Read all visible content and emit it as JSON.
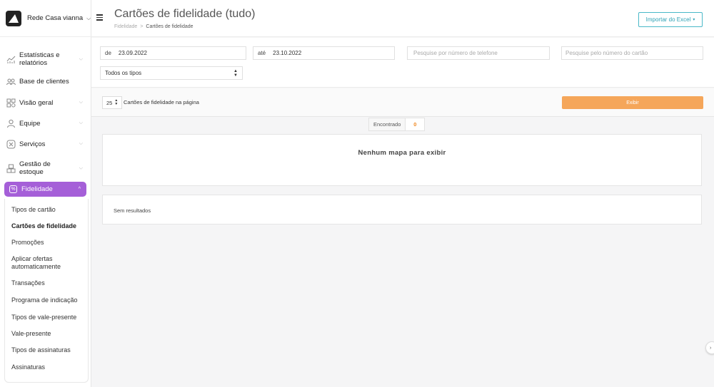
{
  "brand": {
    "name": "Rede Casa vianna"
  },
  "nav": {
    "items": [
      {
        "label": "Estatísticas e relatórios",
        "icon": "chart-icon"
      },
      {
        "label": "Base de clientes",
        "icon": "users-icon"
      },
      {
        "label": "Visão geral",
        "icon": "grid-icon"
      },
      {
        "label": "Equipe",
        "icon": "person-icon"
      },
      {
        "label": "Serviços",
        "icon": "scissors-icon"
      },
      {
        "label": "Gestão de estoque",
        "icon": "boxes-icon"
      }
    ],
    "active": {
      "label": "Fidelidade",
      "icon": "percent-icon"
    },
    "sub_items": [
      "Tipos de cartão",
      "Cartões de fidelidade",
      "Promoções",
      "Aplicar ofertas automaticamente",
      "Transações",
      "Programa de indicação",
      "Tipos de vale-presente",
      "Vale-presente",
      "Tipos de assinaturas",
      "Assinaturas"
    ]
  },
  "header": {
    "title": "Cartões de fidelidade (tudo)",
    "breadcrumb": {
      "parent": "Fidelidade",
      "separator": ">",
      "current": "Cartões de fidelidade"
    },
    "import_button": "Importar do Excel"
  },
  "filters": {
    "from_label": "de",
    "from_value": "23.09.2022",
    "to_label": "até",
    "to_value": "23.10.2022",
    "phone_placeholder": "Pesquise por número de telefone",
    "card_placeholder": "Pesquise pelo número do cartão",
    "type_select": "Todos os tipos"
  },
  "pager": {
    "per_page": "25",
    "per_page_label": "Cartões de fidelidade na página",
    "show_button": "Exibir"
  },
  "results": {
    "found_label": "Encontrado",
    "found_count": "0",
    "map_message": "Nenhum mapa para exibir",
    "empty_message": "Sem resultados"
  },
  "colors": {
    "accent_purple": "#a55fd8",
    "accent_orange": "#f5a65a",
    "accent_teal": "#4ab8c8"
  }
}
